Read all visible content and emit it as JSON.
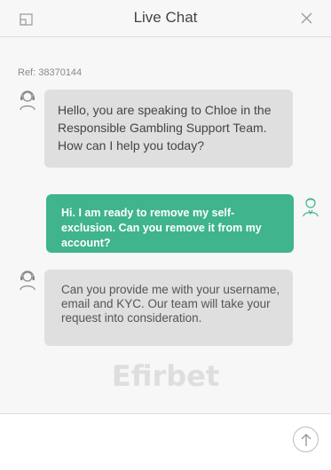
{
  "header": {
    "title": "Live Chat",
    "minimize_icon": "minimize-window-icon",
    "close_icon": "close-icon"
  },
  "chat": {
    "ref": "Ref: 38370144",
    "messages": [
      {
        "sender": "agent",
        "avatar_icon": "agent-headset-icon",
        "text": "Hello, you are speaking to Chloe in the Responsible Gambling Support Team. How can I help you today?"
      },
      {
        "sender": "user",
        "avatar_icon": "user-icon",
        "text": "Hi. I am ready to remove my self-exclusion. Can you remove it from my account?"
      },
      {
        "sender": "agent",
        "avatar_icon": "agent-headset-icon",
        "text": "Can you provide me with your username, email and KYC. Our team will take your request into consideration."
      }
    ],
    "watermark": "Efirbet"
  },
  "composer": {
    "value": "",
    "placeholder": "",
    "send_icon": "send-arrow-up-icon"
  },
  "colors": {
    "user_bubble": "#3fb48d",
    "agent_bubble": "#dfdfdf",
    "background": "#f7f7f7"
  }
}
